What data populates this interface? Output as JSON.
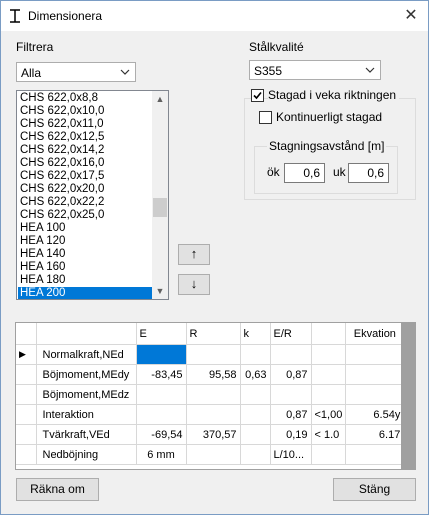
{
  "window": {
    "title": "Dimensionera",
    "close_glyph": "✕"
  },
  "filter": {
    "label": "Filtrera",
    "selected": "Alla"
  },
  "steel": {
    "label": "Stålkvalité",
    "selected": "S355"
  },
  "profiles": {
    "items": [
      "CHS 622,0x8,8",
      "CHS 622,0x10,0",
      "CHS 622,0x11,0",
      "CHS 622,0x12,5",
      "CHS 622,0x14,2",
      "CHS 622,0x16,0",
      "CHS 622,0x17,5",
      "CHS 622,0x20,0",
      "CHS 622,0x22,2",
      "CHS 622,0x25,0",
      "HEA 100",
      "HEA 120",
      "HEA 140",
      "HEA 160",
      "HEA 180",
      "HEA 200"
    ],
    "selected": "HEA 200"
  },
  "move_up_glyph": "↑",
  "move_down_glyph": "↓",
  "bracing": {
    "stagad_label": "Stagad i veka riktningen",
    "stagad_checked": true,
    "kontinuerligt_label": "Kontinuerligt stagad",
    "kontinuerligt_checked": false,
    "group_label": "Stagningsavstånd [m]",
    "ok_label": "ök",
    "ok_value": "0,6",
    "uk_label": "uk",
    "uk_value": "0,6"
  },
  "grid": {
    "headers": [
      "",
      "",
      "E",
      "R",
      "k",
      "E/R",
      "",
      "Ekvation"
    ],
    "row_marker": "▶",
    "rows": [
      [
        "Normalkraft,NEd",
        "",
        "",
        "",
        "",
        "",
        ""
      ],
      [
        "Böjmoment,MEdy",
        "-83,45",
        "95,58",
        "0,63",
        "0,87",
        "",
        ""
      ],
      [
        "Böjmoment,MEdz",
        "",
        "",
        "",
        "",
        "",
        ""
      ],
      [
        "Interaktion",
        "",
        "",
        "",
        "0,87",
        "<1,00",
        "6.54y"
      ],
      [
        "Tvärkraft,VEd",
        "-69,54",
        "370,57",
        "",
        "0,19",
        "< 1.0",
        "6.17"
      ],
      [
        "Nedböjning",
        "6 mm",
        "",
        "",
        "L/10...",
        "",
        ""
      ]
    ]
  },
  "buttons": {
    "recalc": "Räkna om",
    "close": "Stäng"
  }
}
